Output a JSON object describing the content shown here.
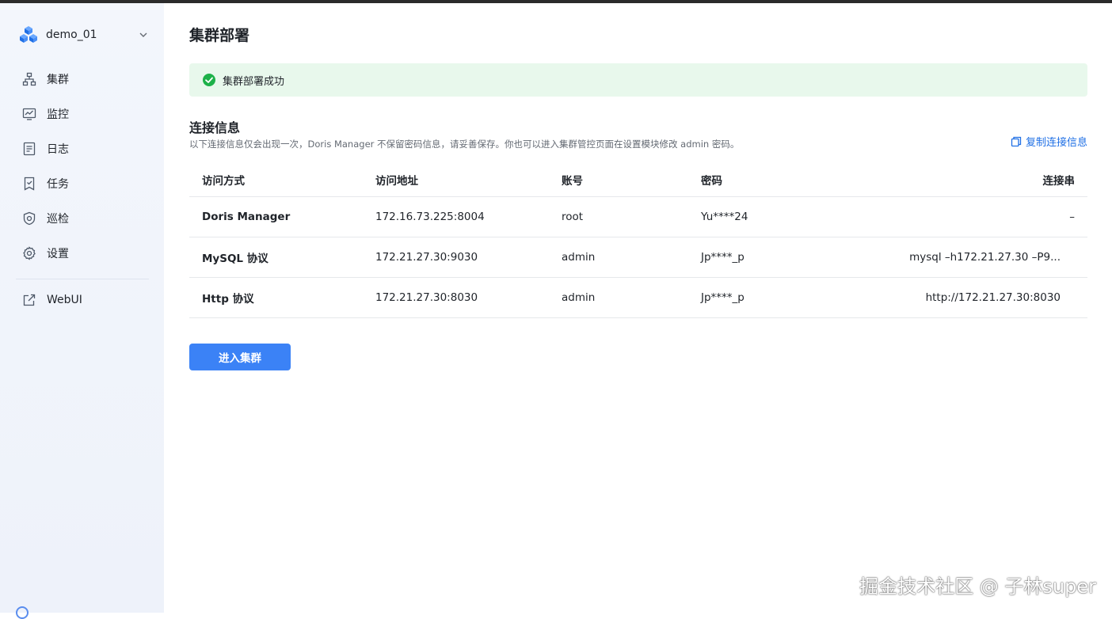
{
  "workspace": {
    "name": "demo_01",
    "logo_icon": "cubes-logo-icon",
    "brand_color": "#1f6fe5"
  },
  "sidebar": {
    "items": [
      {
        "label": "集群",
        "icon": "cluster-icon"
      },
      {
        "label": "监控",
        "icon": "monitor-chart-icon"
      },
      {
        "label": "日志",
        "icon": "log-document-icon"
      },
      {
        "label": "任务",
        "icon": "task-icon"
      },
      {
        "label": "巡检",
        "icon": "shield-inspect-icon"
      },
      {
        "label": "设置",
        "icon": "gear-icon"
      }
    ],
    "webui": {
      "label": "WebUI",
      "icon": "external-link-icon"
    }
  },
  "page": {
    "title": "集群部署",
    "alert": {
      "text": "集群部署成功",
      "color": "#e8f8ec",
      "icon": "success-check-icon"
    },
    "section_title": "连接信息",
    "section_desc": "以下连接信息仅会出现一次，Doris Manager 不保留密码信息，请妥善保存。你也可以进入集群管控页面在设置模块修改 admin 密码。",
    "copy_label": "复制连接信息",
    "table": {
      "headers": [
        "访问方式",
        "访问地址",
        "账号",
        "密码",
        "连接串"
      ],
      "rows": [
        [
          "Doris Manager",
          "172.16.73.225:8004",
          "root",
          "Yu****24",
          "–"
        ],
        [
          "MySQL 协议",
          "172.21.27.30:9030",
          "admin",
          "Jp****_p",
          "mysql –h172.21.27.30 –P9..."
        ],
        [
          "Http 协议",
          "172.21.27.30:8030",
          "admin",
          "Jp****_p",
          "http://172.21.27.30:8030"
        ]
      ]
    },
    "enter_button": "进入集群",
    "button_color": "#3b82f6"
  },
  "watermark": "掘金技术社区 @ 子林super"
}
